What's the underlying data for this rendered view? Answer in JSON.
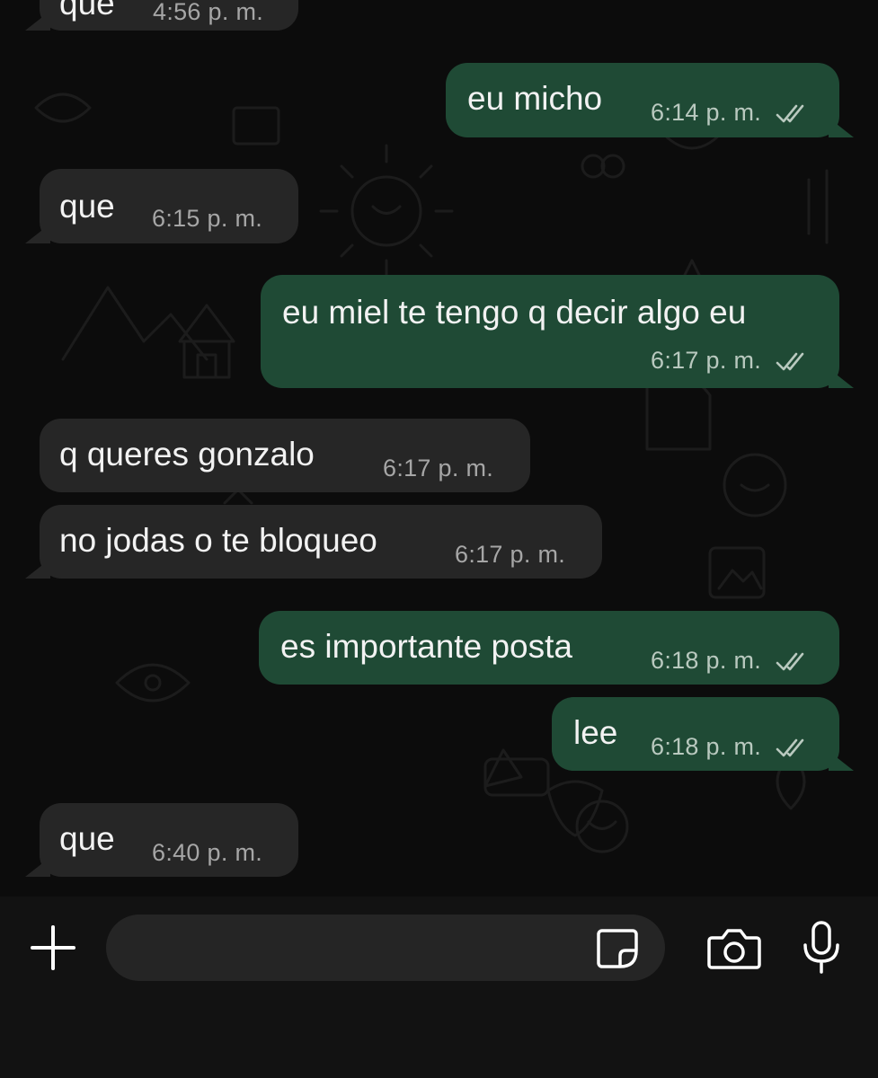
{
  "theme": {
    "incoming_bubble": "#262626",
    "outgoing_bubble": "#1f4a35",
    "background": "#0c0c0c",
    "read_ticks": "#b9c9bf"
  },
  "messages": [
    {
      "direction": "in",
      "text": "que",
      "time": "4:56 p. m."
    },
    {
      "direction": "out",
      "text": "eu micho",
      "time": "6:14 p. m.",
      "status": "double-check-read"
    },
    {
      "direction": "in",
      "text": "que",
      "time": "6:15 p. m."
    },
    {
      "direction": "out",
      "text": "eu miel te tengo q decir algo eu",
      "time": "6:17 p. m.",
      "status": "double-check-read"
    },
    {
      "direction": "in",
      "text": "q queres gonzalo",
      "time": "6:17 p. m."
    },
    {
      "direction": "in",
      "text": "no jodas o te bloqueo",
      "time": "6:17 p. m."
    },
    {
      "direction": "out",
      "text": "es importante posta",
      "time": "6:18 p. m.",
      "status": "double-check-read"
    },
    {
      "direction": "out",
      "text": "lee",
      "time": "6:18 p. m.",
      "status": "double-check-read"
    },
    {
      "direction": "in",
      "text": "que",
      "time": "6:40 p. m."
    }
  ],
  "composer": {
    "input_value": "",
    "icons": [
      "plus-icon",
      "sticker-icon",
      "camera-icon",
      "microphone-icon"
    ]
  }
}
